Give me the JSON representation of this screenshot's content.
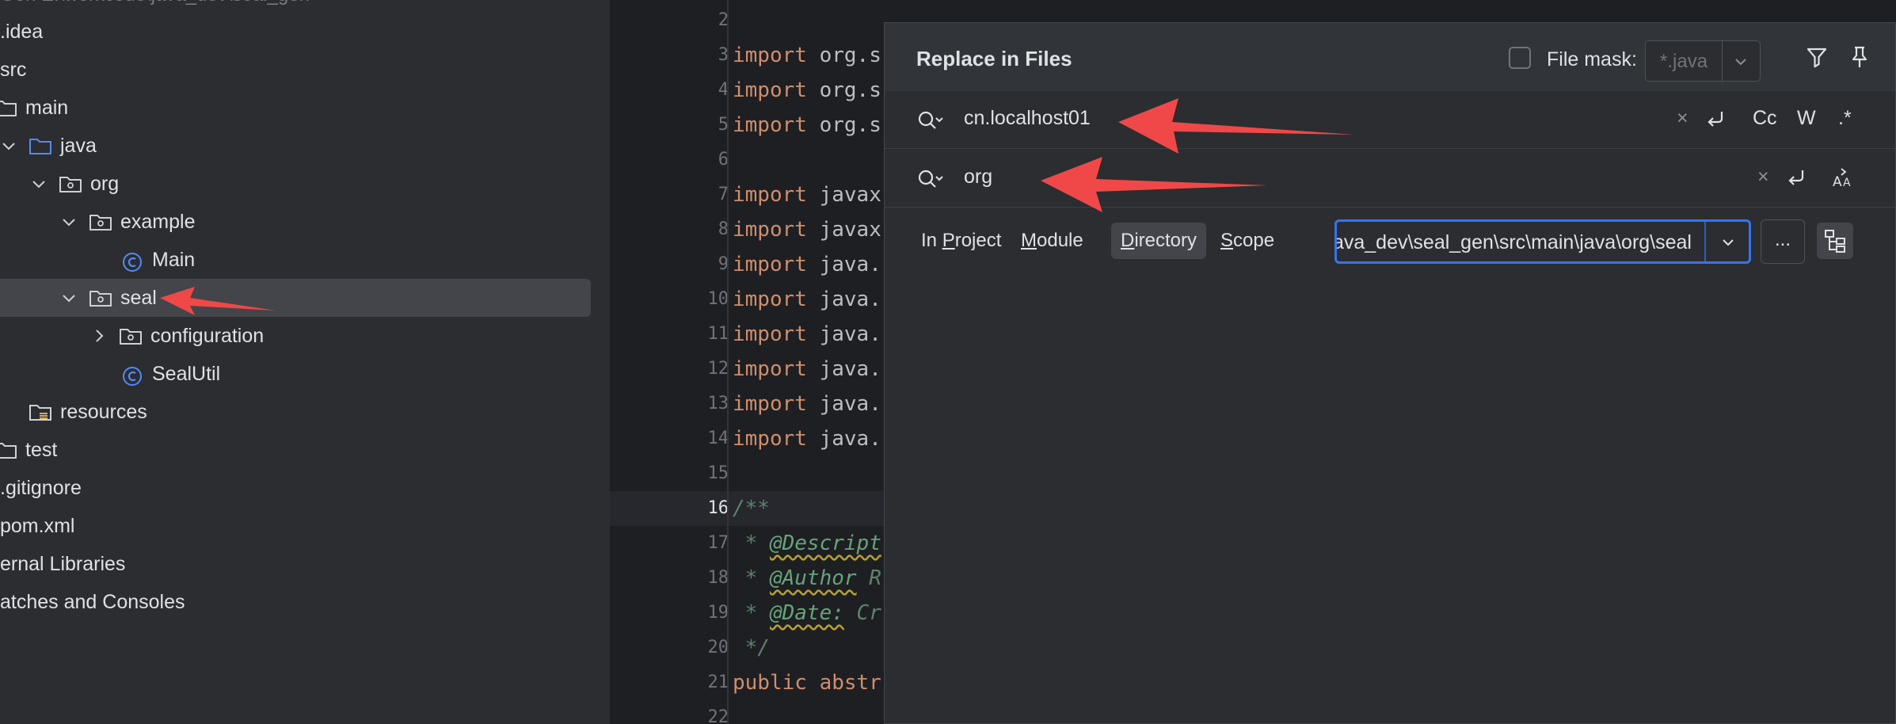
{
  "project_tree": {
    "path_top": "Gen  E:\\workcode\\java_dev\\seal_gen",
    "items": [
      {
        "label": ".idea",
        "indent": 0
      },
      {
        "label": "src",
        "indent": 0
      },
      {
        "label": "main",
        "indent": 1
      },
      {
        "label": "java",
        "indent": 1
      },
      {
        "label": "org",
        "indent": 2
      },
      {
        "label": "example",
        "indent": 3
      },
      {
        "label": "Main",
        "indent": 4
      },
      {
        "label": "seal",
        "indent": 3
      },
      {
        "label": "configuration",
        "indent": 4
      },
      {
        "label": "SealUtil",
        "indent": 4
      },
      {
        "label": "resources",
        "indent": 1
      },
      {
        "label": "test",
        "indent": 0
      },
      {
        "label": ".gitignore",
        "indent": 0
      },
      {
        "label": "pom.xml",
        "indent": 0
      },
      {
        "label": "ernal Libraries",
        "indent": 0
      },
      {
        "label": "atches and Consoles",
        "indent": 0
      }
    ]
  },
  "editor": {
    "current_line": "16",
    "lines": [
      {
        "n": "2",
        "kw": "",
        "text": ""
      },
      {
        "n": "3",
        "kw": "import",
        "text": " org.s"
      },
      {
        "n": "4",
        "kw": "import",
        "text": " org.s"
      },
      {
        "n": "5",
        "kw": "import",
        "text": " org.s"
      },
      {
        "n": "6",
        "kw": "",
        "text": ""
      },
      {
        "n": "7",
        "kw": "import",
        "text": " javax"
      },
      {
        "n": "8",
        "kw": "import",
        "text": " javax"
      },
      {
        "n": "9",
        "kw": "import",
        "text": " java."
      },
      {
        "n": "10",
        "kw": "import",
        "text": " java."
      },
      {
        "n": "11",
        "kw": "import",
        "text": " java."
      },
      {
        "n": "12",
        "kw": "import",
        "text": " java."
      },
      {
        "n": "13",
        "kw": "import",
        "text": " java."
      },
      {
        "n": "14",
        "kw": "import",
        "text": " java."
      },
      {
        "n": "15",
        "kw": "",
        "text": ""
      },
      {
        "n": "16",
        "doc": "/**"
      },
      {
        "n": "17",
        "doc": " * ",
        "tag": "@Descript"
      },
      {
        "n": "18",
        "doc": " * ",
        "tag": "@Author",
        "rest": " R"
      },
      {
        "n": "19",
        "doc": " * ",
        "tag": "@Date:",
        "rest": " Cr"
      },
      {
        "n": "20",
        "doc": " */"
      },
      {
        "n": "21",
        "kw": "public abstr",
        "text": ""
      },
      {
        "n": "22",
        "kw": "",
        "text": ""
      }
    ]
  },
  "dialog": {
    "title": "Replace in Files",
    "file_mask_label": "File mask:",
    "file_mask_value": "*.java",
    "search_text": "cn.localhost01",
    "replace_text": "org",
    "search_options": {
      "case": "Cc",
      "words": "W",
      "regex": ".*"
    },
    "scope_tabs": [
      {
        "pre": "In ",
        "u": "P",
        "post": "roject",
        "active": false
      },
      {
        "pre": "",
        "u": "M",
        "post": "odule",
        "active": false
      },
      {
        "pre": "",
        "u": "D",
        "post": "irectory",
        "active": true
      },
      {
        "pre": "",
        "u": "S",
        "post": "cope",
        "active": false
      }
    ],
    "directory_value": "E:\\workcode\\java_dev\\seal_gen\\src\\main\\java\\org\\seal",
    "more_button": "..."
  },
  "colors": {
    "accent": "#3574f0",
    "annotation_arrow": "#f04848",
    "keyword": "#cf8e6d",
    "doc_comment": "#5f826b"
  }
}
